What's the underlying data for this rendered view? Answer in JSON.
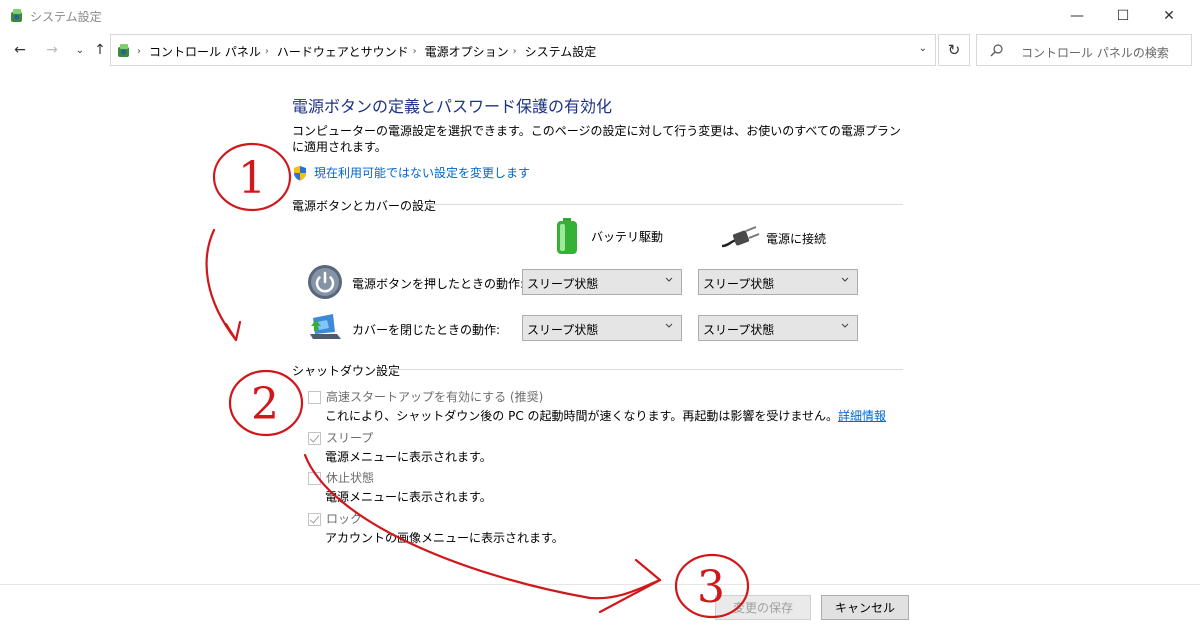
{
  "window": {
    "title": "システム設定",
    "min_glyph": "—",
    "max_glyph": "☐",
    "close_glyph": "✕"
  },
  "nav": {
    "back": "←",
    "forward": "→",
    "recent": "⌄",
    "up": "↑",
    "breadcrumb": [
      "コントロール パネル",
      "ハードウェアとサウンド",
      "電源オプション",
      "システム設定"
    ],
    "sep": "›",
    "dropdown": "⌄",
    "refresh": "↻",
    "search_placeholder": "コントロール パネルの検索"
  },
  "content": {
    "title": "電源ボタンの定義とパスワード保護の有効化",
    "description": "コンピューターの電源設定を選択できます。このページの設定に対して行う変更は、お使いのすべての電源プランに適用されます。",
    "admin_link": "現在利用可能ではない設定を変更します",
    "power_section": "電源ボタンとカバーの設定",
    "col_battery": "バッテリ駆動",
    "col_plugged": "電源に接続",
    "rows": [
      {
        "label": "電源ボタンを押したときの動作:",
        "battery": "スリープ状態",
        "plugged": "スリープ状態"
      },
      {
        "label": "カバーを閉じたときの動作:",
        "battery": "スリープ状態",
        "plugged": "スリープ状態"
      }
    ],
    "shutdown_section": "シャットダウン設定",
    "options": [
      {
        "label": "高速スタートアップを有効にする (推奨)",
        "checked": false,
        "desc": "これにより、シャットダウン後の PC の起動時間が速くなります。再起動は影響を受けません。",
        "link": "詳細情報"
      },
      {
        "label": "スリープ",
        "checked": true,
        "desc": "電源メニューに表示されます。"
      },
      {
        "label": "休止状態",
        "checked": false,
        "desc": "電源メニューに表示されます。"
      },
      {
        "label": "ロック",
        "checked": true,
        "desc": "アカウントの画像メニューに表示されます。"
      }
    ]
  },
  "footer": {
    "save": "変更の保存",
    "cancel": "キャンセル"
  },
  "annotations": {
    "marks": [
      "1",
      "2",
      "3"
    ],
    "ink_color": "#d0181c"
  }
}
